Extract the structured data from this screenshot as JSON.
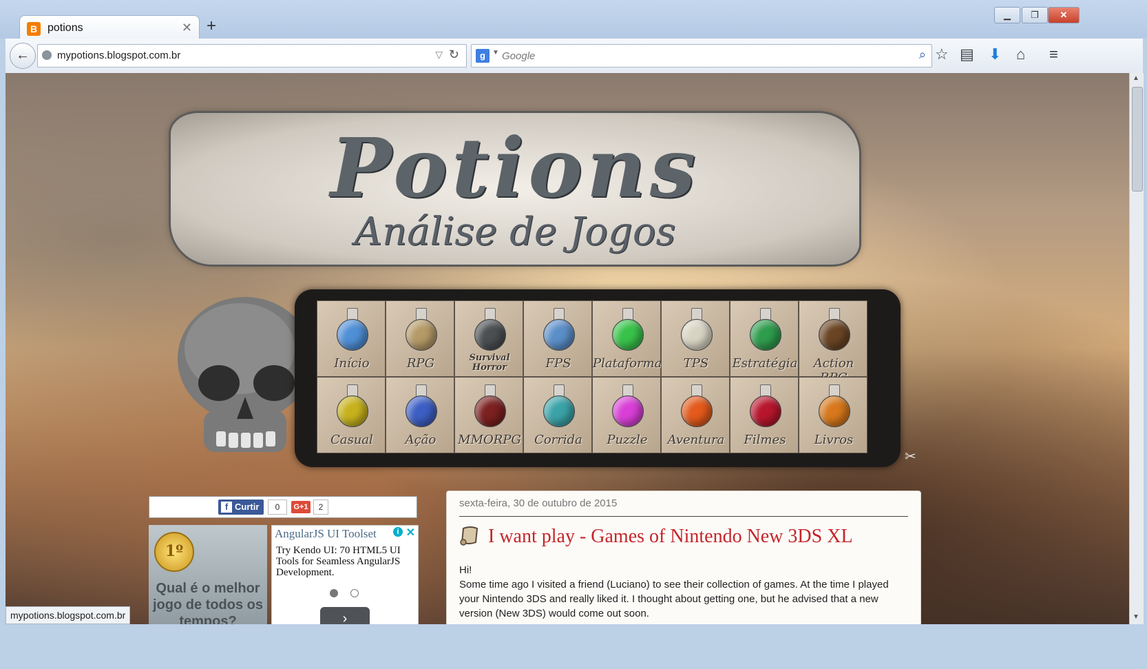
{
  "browser": {
    "tab_title": "potions",
    "favicon_letter": "B",
    "url": "mypotions.blogspot.com.br",
    "search_placeholder": "Google",
    "search_engine_letter": "g",
    "status_url": "mypotions.blogspot.com.br"
  },
  "banner": {
    "title": "Potions",
    "subtitle": "Análise de Jogos"
  },
  "menu": {
    "items": [
      {
        "label": "Início",
        "color": "#4f8fd6"
      },
      {
        "label": "RPG",
        "color": "#b59a68"
      },
      {
        "label": "Survival Horror",
        "color": "#4b4f52"
      },
      {
        "label": "FPS",
        "color": "#5b8ec8"
      },
      {
        "label": "Plataforma",
        "color": "#39c24a"
      },
      {
        "label": "TPS",
        "color": "#d8d4c4"
      },
      {
        "label": "Estratégia",
        "color": "#2e9c4d"
      },
      {
        "label": "Action RPG",
        "color": "#6a4424"
      },
      {
        "label": "Casual",
        "color": "#c7b21d"
      },
      {
        "label": "Ação",
        "color": "#3d5fc4"
      },
      {
        "label": "MMORPG",
        "color": "#7c2020"
      },
      {
        "label": "Corrida",
        "color": "#3aa3a8"
      },
      {
        "label": "Puzzle",
        "color": "#d93fd6"
      },
      {
        "label": "Aventura",
        "color": "#e35a1c"
      },
      {
        "label": "Filmes",
        "color": "#b8162d"
      },
      {
        "label": "Livros",
        "color": "#d7781c"
      }
    ]
  },
  "social": {
    "like_label": "Curtir",
    "like_count": "0",
    "gplus_label": "G+1",
    "gplus_count": "2"
  },
  "poll": {
    "medal_text": "1º",
    "question": "Qual é o melhor jogo de todos os tempos?"
  },
  "ad": {
    "title": "AngularJS UI Toolset",
    "body": "Try Kendo UI: 70 HTML5 UI Tools for Seamless AngularJS Development.",
    "close": "✕",
    "info": "i"
  },
  "post": {
    "date": "sexta-feira, 30 de outubro de 2015",
    "title": "I want play - Games of Nintendo New 3DS XL",
    "greeting": "Hi!",
    "paragraph": "Some time ago I visited a friend (Luciano) to see their collection of games. At the time I played your Nintendo 3DS and really liked it. I thought about getting one, but he advised that a new version (New 3DS) would come out soon."
  }
}
